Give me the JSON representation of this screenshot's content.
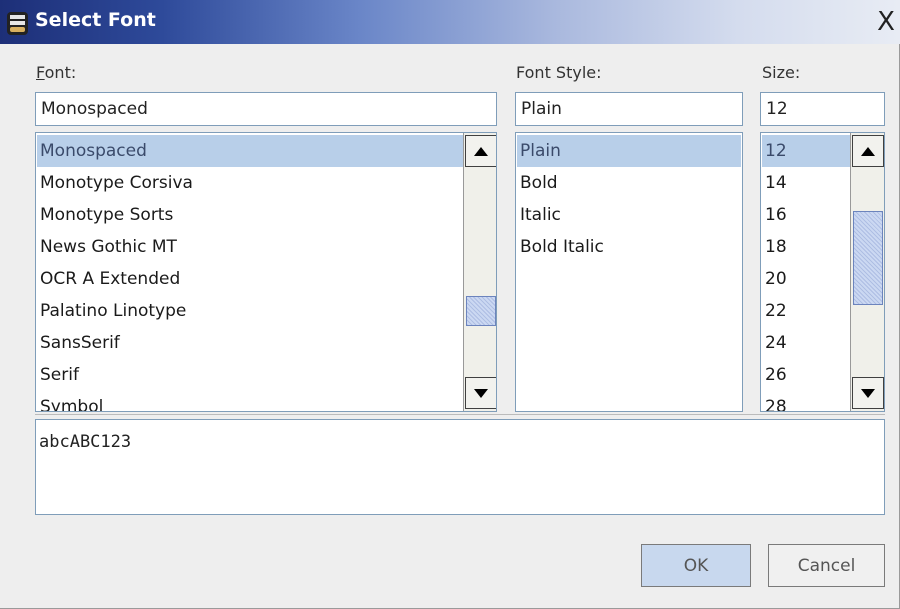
{
  "window": {
    "title": "Select Font",
    "close_glyph": "X"
  },
  "font": {
    "label": "Font:",
    "label_mnemonic": "F",
    "value": "Monospaced",
    "items": [
      "Monospaced",
      "Monotype Corsiva",
      "Monotype Sorts",
      "News Gothic MT",
      "OCR A Extended",
      "Palatino Linotype",
      "SansSerif",
      "Serif",
      "Symbol"
    ],
    "selected": "Monospaced"
  },
  "style": {
    "label": "Font Style:",
    "value": "Plain",
    "items": [
      "Plain",
      "Bold",
      "Italic",
      "Bold Italic"
    ],
    "selected": "Plain"
  },
  "size": {
    "label": "Size:",
    "value": "12",
    "items": [
      "12",
      "14",
      "16",
      "18",
      "20",
      "22",
      "24",
      "26",
      "28"
    ],
    "selected": "12"
  },
  "preview": {
    "text": "abcABC123"
  },
  "buttons": {
    "ok": "OK",
    "cancel": "Cancel"
  },
  "colors": {
    "selection": "#b8cfe9",
    "title_bar_start": "#1d2f78",
    "field_border": "#7f9db9",
    "ok_button": "#c8d8ee"
  },
  "icons": {
    "app": "dialog-app-icon",
    "up": "arrow-up-icon",
    "down": "arrow-down-icon",
    "close": "close-icon"
  }
}
